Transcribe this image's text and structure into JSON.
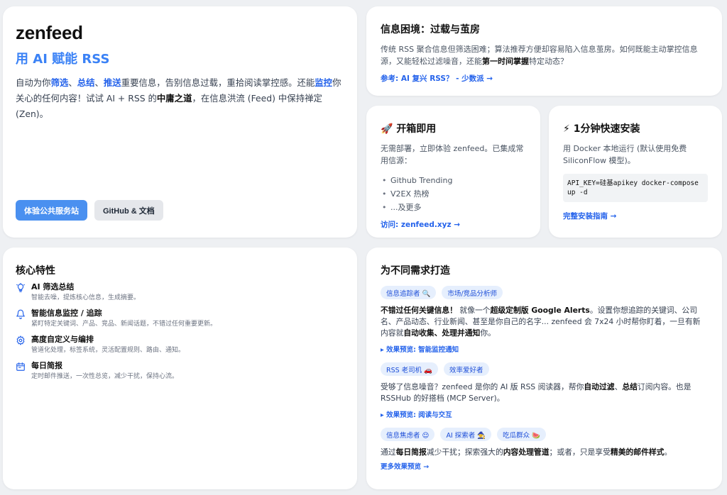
{
  "hero": {
    "logo": "zenfeed",
    "tagline": "用 AI 赋能 RSS",
    "desc": {
      "p1": "自动为你",
      "k1": "筛选",
      "sep1": "、",
      "k2": "总结",
      "sep2": "、",
      "k3": "推送",
      "p2": "重要信息，告别信息过载，重拾阅读掌控感。还能",
      "k4": "监控",
      "p3": "你关心的任何内容！试试 AI + RSS 的",
      "k5": "中庸之道",
      "p4": "，在信息洪流 (Feed) 中保持禅定 (Zen)。"
    },
    "primary_button": "体验公共服务站",
    "secondary_button": "GitHub & 文档"
  },
  "dilemma": {
    "title": "信息困境：过载与茧房",
    "text_a": "传统 RSS 聚合信息但筛选困难；算法推荐方便却容易陷入信息茧房。如何既能主动掌控信息源，又能轻松过滤噪音，还能",
    "text_bold": "第一时间掌握",
    "text_b": "特定动态？",
    "link": "参考: AI 复兴 RSS？ - 少数派 →"
  },
  "quick": {
    "icon": "🚀",
    "title": "开箱即用",
    "text": "无需部署，立即体验 zenfeed。已集成常用信源：",
    "items": [
      "Github Trending",
      "V2EX 热榜",
      "...及更多"
    ],
    "link": "访问: zenfeed.xyz →"
  },
  "install": {
    "icon": "⚡",
    "title": "1分钟快速安装",
    "text": "用 Docker 本地运行 (默认使用免费 SiliconFlow 模型)。",
    "code": "API_KEY=硅基apikey docker-compose up -d",
    "link": "完整安装指南 →"
  },
  "features": {
    "title": "核心特性",
    "items": [
      {
        "icon": "bulb-icon",
        "title": "AI 筛选总结",
        "desc": "智能去噪，提炼核心信息，生成摘要。"
      },
      {
        "icon": "bell-icon",
        "title": "智能信息监控 / 追踪",
        "desc": "紧盯特定关键词、产品、竞品、新闻话题，不错过任何重要更新。"
      },
      {
        "icon": "gear-icon",
        "title": "高度自定义与编排",
        "desc": "管道化处理，标签系统，灵活配置规则、路由、通知。"
      },
      {
        "icon": "calendar-icon",
        "title": "每日简报",
        "desc": "定时邮件推送，一次性总览，减少干扰，保持心流。"
      }
    ]
  },
  "needs": {
    "title": "为不同需求打造",
    "group1": {
      "tags": [
        "信息追踪者 🔍",
        "市场/竞品分析师"
      ],
      "b1": "不错过任何关键信息！",
      "t1": " 就像一个",
      "b2": "超级定制版 Google Alerts",
      "t2": "。设置你想追踪的关键词、公司名、产品动态、行业新闻、甚至是你自己的名字... zenfeed 会 7x24 小时帮你盯着，一旦有新内容就",
      "b3": "自动收集、处理并通知",
      "t3": "你。",
      "preview": "▸ 效果预览: 智能监控通知"
    },
    "group2": {
      "tags": [
        "RSS 老司机 🚗",
        "效率爱好者"
      ],
      "t1": "受够了信息噪音？zenfeed 是你的 AI 版 RSS 阅读器，帮你",
      "b1": "自动过滤",
      "t2": "、",
      "b2": "总结",
      "t3": "订阅内容。也是 RSSHub 的好搭档 (MCP Server)。",
      "preview": "▸ 效果预览: 阅读与交互"
    },
    "group3": {
      "tags": [
        "信息焦虑者 😌",
        "AI 探索者 🧙",
        "吃瓜群众 🍉"
      ],
      "t1": "通过",
      "b1": "每日简报",
      "t2": "减少干扰；探索强大的",
      "b2": "内容处理管道",
      "t3": "；或者，只是享受",
      "b3": "精美的邮件样式",
      "t4": "。",
      "preview": "更多效果预览 →"
    }
  },
  "colors": {
    "accent": "#3b82f6",
    "link": "#2563eb",
    "tag_bg": "#e6effd"
  }
}
